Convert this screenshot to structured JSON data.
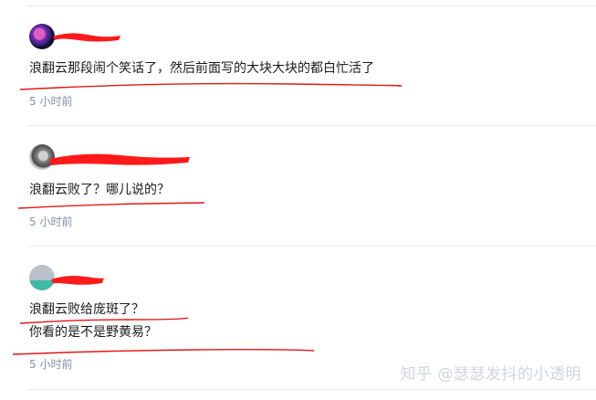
{
  "comments": [
    {
      "text": "浪翻云那段闹个笑话了，然后前面写的大块大块的都白忙活了",
      "time": "5 小时前",
      "avatar_icon": "user-avatar"
    },
    {
      "text": "浪翻云败了？哪儿说的？",
      "time": "5 小时前",
      "avatar_icon": "user-avatar"
    },
    {
      "text_lines": [
        "浪翻云败给庞斑了？",
        "你看的是不是野黄易？"
      ],
      "time": "5 小时前",
      "avatar_icon": "user-avatar"
    }
  ],
  "watermark": "知乎 @瑟瑟发抖的小透明",
  "colors": {
    "redact": "#ff1a1a",
    "annotation": "#e01818",
    "meta": "#8590a6"
  }
}
